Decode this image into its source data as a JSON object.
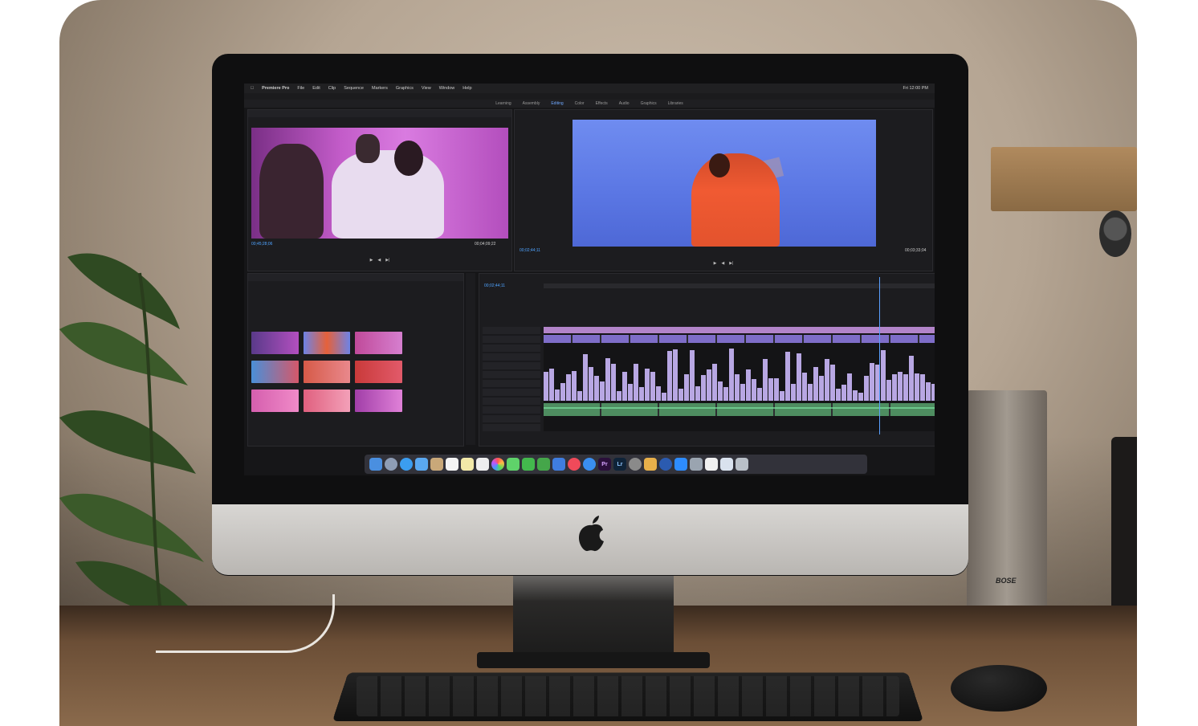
{
  "screen": {
    "menubar": {
      "app_name": "Premiere Pro",
      "menus": [
        "File",
        "Edit",
        "Clip",
        "Sequence",
        "Markers",
        "Graphics",
        "View",
        "Window",
        "Help"
      ],
      "clock": "Fri 12:00 PM"
    },
    "workspace_tabs": [
      "Learning",
      "Assembly",
      "Editing",
      "Color",
      "Effects",
      "Audio",
      "Graphics",
      "Libraries"
    ],
    "active_workspace": "Editing",
    "source_monitor": {
      "timecode_left": "00;45;28;06",
      "timecode_right": "00;04;09;22"
    },
    "program_monitor": {
      "timecode_left": "00;02;44;11",
      "timecode_right": "00;03;33;04"
    },
    "timeline": {
      "timecode": "00;02;44;11"
    },
    "dock_labels": {
      "premiere": "Pr",
      "lightroom": "Lr"
    }
  },
  "hardware": {
    "speaker_brand": "BOSE"
  },
  "colors": {
    "source_video": "#c35cc9",
    "program_video": "#6f8cf0",
    "orange_figure": "#f05a32",
    "clip_purple": "#b8a7e3",
    "audio_green": "#4e8d60"
  }
}
